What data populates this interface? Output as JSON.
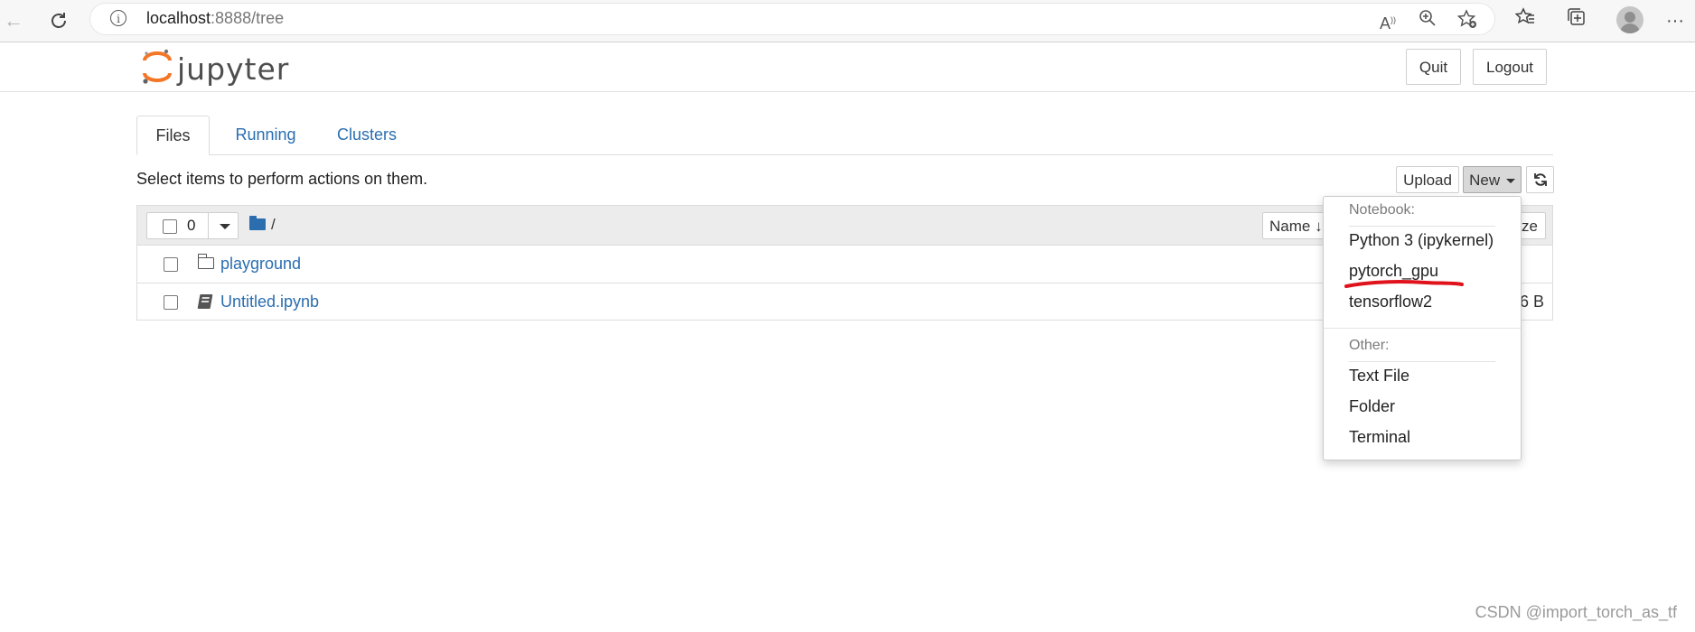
{
  "browser": {
    "url_host": "localhost",
    "url_path": ":8888/tree"
  },
  "header": {
    "logo_text": "jupyter",
    "quit_label": "Quit",
    "logout_label": "Logout"
  },
  "tabs": [
    {
      "label": "Files",
      "active": true
    },
    {
      "label": "Running",
      "active": false
    },
    {
      "label": "Clusters",
      "active": false
    }
  ],
  "toolbar": {
    "hint": "Select items to perform actions on them.",
    "upload_label": "Upload",
    "new_label": "New"
  },
  "list_header": {
    "selected_count": "0",
    "breadcrumb": "/",
    "sort_name_label": "Name",
    "size_label": "ze"
  },
  "files": [
    {
      "name": "playground",
      "type": "folder",
      "size": ""
    },
    {
      "name": "Untitled.ipynb",
      "type": "notebook",
      "size": "6 B"
    }
  ],
  "new_menu": {
    "notebook_header": "Notebook:",
    "notebook_items": [
      "Python 3 (ipykernel)",
      "pytorch_gpu",
      "tensorflow2"
    ],
    "other_header": "Other:",
    "other_items": [
      "Text File",
      "Folder",
      "Terminal"
    ]
  },
  "watermark": "CSDN @import_torch_as_tf",
  "colors": {
    "link": "#2a6eb0",
    "annotation": "#e0121b",
    "logo_orange": "#f37726"
  }
}
